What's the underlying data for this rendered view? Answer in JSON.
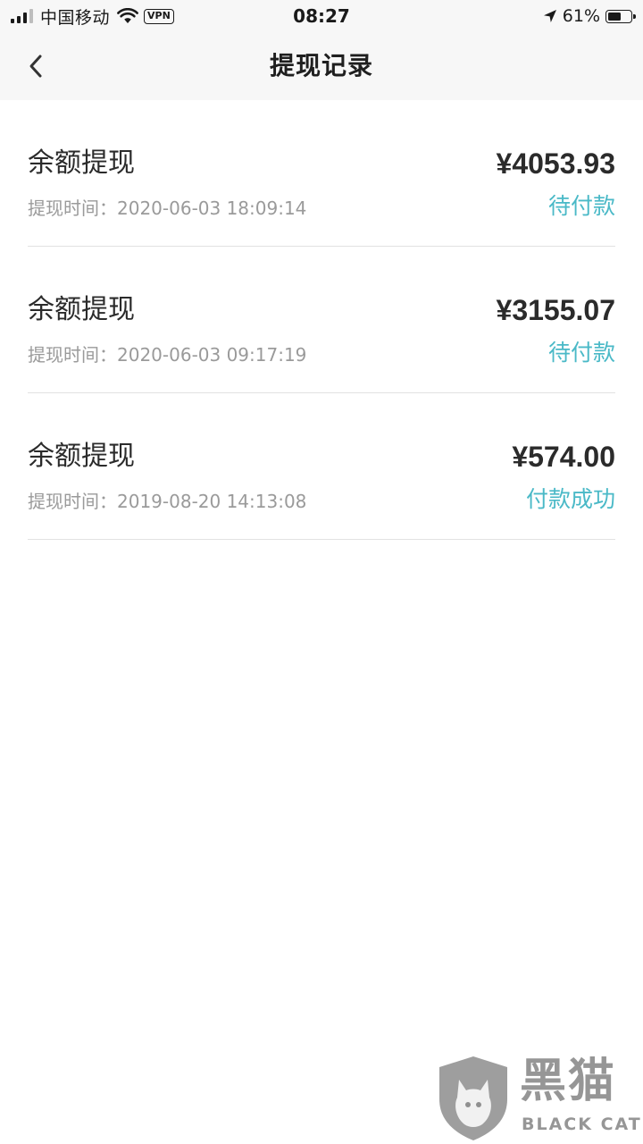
{
  "status_bar": {
    "carrier": "中国移动",
    "vpn": "VPN",
    "time": "08:27",
    "battery_percent": "61%",
    "battery_level": 0.61
  },
  "nav": {
    "back_icon": "chevron-left-icon",
    "title": "提现记录"
  },
  "records": [
    {
      "type": "余额提现",
      "amount": "¥4053.93",
      "time": "提现时间：2020-06-03 18:09:14",
      "status": "待付款"
    },
    {
      "type": "余额提现",
      "amount": "¥3155.07",
      "time": "提现时间：2020-06-03 09:17:19",
      "status": "待付款"
    },
    {
      "type": "余额提现",
      "amount": "¥574.00",
      "time": "提现时间：2019-08-20 14:13:08",
      "status": "付款成功"
    }
  ],
  "colors": {
    "status_accent": "#4ab9c7",
    "header_bg": "#f7f7f7",
    "divider": "#e2e2e2"
  },
  "watermark": {
    "cn": "黑猫",
    "en": "BLACK CAT"
  }
}
